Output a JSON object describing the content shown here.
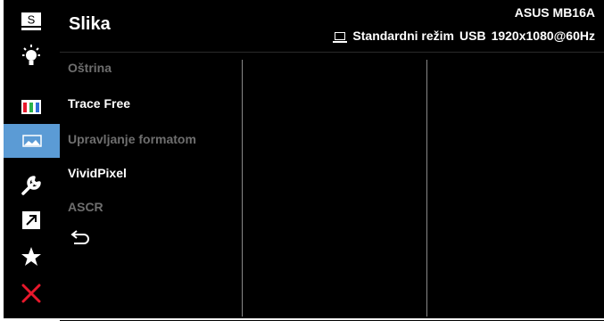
{
  "sidebar": {
    "items": [
      {
        "name": "splendid-icon",
        "glyph": "S"
      },
      {
        "name": "brightness-icon"
      },
      {
        "name": "color-icon"
      },
      {
        "name": "image-icon",
        "active": true
      },
      {
        "name": "setup-wrench-icon"
      },
      {
        "name": "shortcut-icon"
      },
      {
        "name": "favorite-star-icon"
      },
      {
        "name": "close-icon"
      }
    ]
  },
  "header": {
    "title": "Slika",
    "model": "ASUS MB16A",
    "mode": "Standardni režim",
    "input": "USB",
    "resolution": "1920x1080@60Hz"
  },
  "menu": {
    "items": [
      {
        "label": "Oštrina",
        "enabled": false
      },
      {
        "label": "Trace Free",
        "enabled": true
      },
      {
        "label": "Upravljanje formatom",
        "enabled": false
      },
      {
        "label": "VividPixel",
        "enabled": true
      },
      {
        "label": "ASCR",
        "enabled": false
      }
    ]
  },
  "colors": {
    "accent": "#5b9bd5",
    "background": "#000000",
    "text": "#ffffff",
    "disabled_text": "#6e6e6e",
    "close_red": "#e8182c"
  }
}
